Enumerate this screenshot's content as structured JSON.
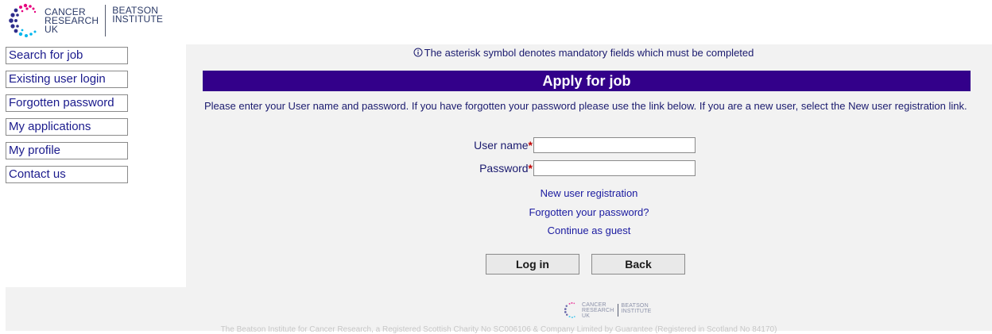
{
  "header": {
    "logo_cancer": "CANCER",
    "logo_research": "RESEARCH",
    "logo_uk": "UK",
    "logo_beatson": "BEATSON",
    "logo_institute": "INSTITUTE"
  },
  "sidebar": {
    "items": [
      {
        "label": "Search for job"
      },
      {
        "label": "Existing user login"
      },
      {
        "label": "Forgotten password"
      },
      {
        "label": "My applications"
      },
      {
        "label": "My profile"
      },
      {
        "label": "Contact us"
      }
    ]
  },
  "main": {
    "asterisk_note": "The asterisk symbol denotes mandatory fields which must be completed",
    "title": "Apply for job",
    "intro": "Please enter your User name and password. If you have forgotten your password please use the link below. If you are a new user, select the New user registration link.",
    "username_label": "User name",
    "password_label": "Password",
    "required_mark": "*",
    "username_value": "",
    "password_value": "",
    "links": {
      "new_user": "New user registration",
      "forgot": "Forgotten your password?",
      "guest": "Continue as guest"
    },
    "buttons": {
      "login": "Log in",
      "back": "Back"
    }
  },
  "footer": {
    "logo_cancer": "CANCER",
    "logo_research": "RESEARCH",
    "logo_uk": "UK",
    "logo_beatson": "BEATSON",
    "logo_institute": "INSTITUTE",
    "text": "The Beatson Institute for Cancer Research, a Registered Scottish Charity No SC006106 & Company Limited by Guarantee (Registered in Scotland No 84170)"
  },
  "colors": {
    "title_bar": "#33008a",
    "link": "#1a1aa0",
    "required": "#c00000"
  }
}
